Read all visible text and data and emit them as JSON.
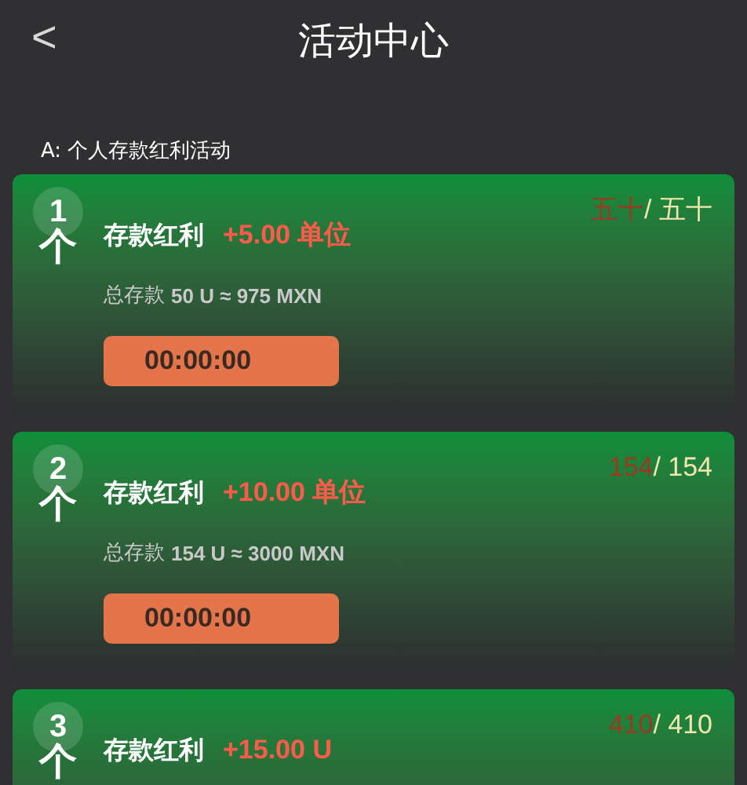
{
  "header": {
    "back": "<",
    "title": "活动中心"
  },
  "section": {
    "label": "A:  个人存款红利活动"
  },
  "cards": [
    {
      "number": "1",
      "unit": "个",
      "title": "存款红利",
      "bonus": "+5.00 单位",
      "progress_current": "五十",
      "progress_total": "/ 五十",
      "deposit_label": "总存款",
      "deposit_value": "50 U ≈ 975 MXN",
      "timer": "00:00:00"
    },
    {
      "number": "2",
      "unit": "个",
      "title": "存款红利",
      "bonus": "+10.00 单位",
      "progress_current": "154",
      "progress_total": "/ 154",
      "deposit_label": "总存款",
      "deposit_value": "154 U ≈ 3000 MXN",
      "timer": "00:00:00"
    },
    {
      "number": "3",
      "unit": "个",
      "title": "存款红利",
      "bonus": "+15.00 U",
      "progress_current": "410",
      "progress_total": "/ 410"
    }
  ]
}
